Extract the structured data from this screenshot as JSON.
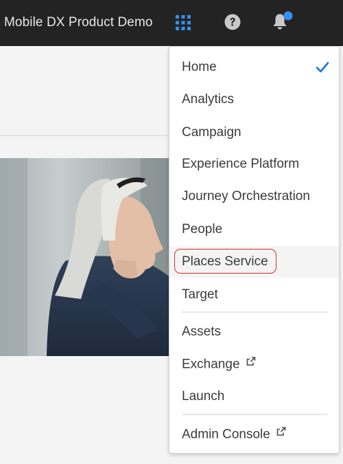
{
  "header": {
    "org_name": "Mobile DX Product Demo",
    "icons": {
      "apps": "apps-grid-icon",
      "help": "help-icon",
      "notifications": "bell-icon"
    },
    "colors": {
      "bar_bg": "#232323",
      "accent": "#378ef0"
    }
  },
  "app_switcher": {
    "selected": "Home",
    "items": [
      {
        "label": "Home",
        "checked": true
      },
      {
        "label": "Analytics"
      },
      {
        "label": "Campaign"
      },
      {
        "label": "Experience Platform"
      },
      {
        "label": "Journey Orchestration"
      },
      {
        "label": "People"
      },
      {
        "label": "Places Service",
        "hovered": true,
        "annotated": true
      },
      {
        "label": "Target"
      },
      {
        "label": "Assets"
      },
      {
        "label": "Exchange",
        "external": true
      },
      {
        "label": "Launch"
      },
      {
        "label": "Admin Console",
        "external": true
      }
    ],
    "colors": {
      "check": "#1473e6",
      "annotation_ring": "#d12b2b"
    }
  }
}
